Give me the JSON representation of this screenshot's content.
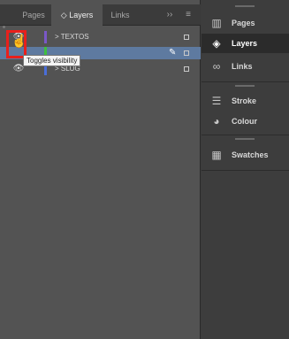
{
  "tabs": {
    "pages": "Pages",
    "layers": "◇ Layers",
    "links": "Links",
    "collapse": "››",
    "menu": "≡"
  },
  "layers": [
    {
      "name": "> TEXTOS",
      "color": "#7a58c8"
    },
    {
      "name": "",
      "color": "#3fbf3f"
    },
    {
      "name": "> SLUG",
      "color": "#4a6ed8"
    }
  ],
  "tooltip": "Toggles visibility",
  "icons": {
    "eye": "👁",
    "hand": "☝",
    "pen": "✎"
  },
  "dock": {
    "pages": {
      "label": "Pages",
      "icon": "▥"
    },
    "layers": {
      "label": "Layers",
      "icon": "◈"
    },
    "links": {
      "label": "Links",
      "icon": "∞"
    },
    "stroke": {
      "label": "Stroke",
      "icon": "☰"
    },
    "colour": {
      "label": "Colour",
      "icon": "◕"
    },
    "swatches": {
      "label": "Swatches",
      "icon": "▦"
    }
  },
  "colors": {
    "highlight": "#e8201c",
    "selected_row": "#5e7aa0"
  }
}
